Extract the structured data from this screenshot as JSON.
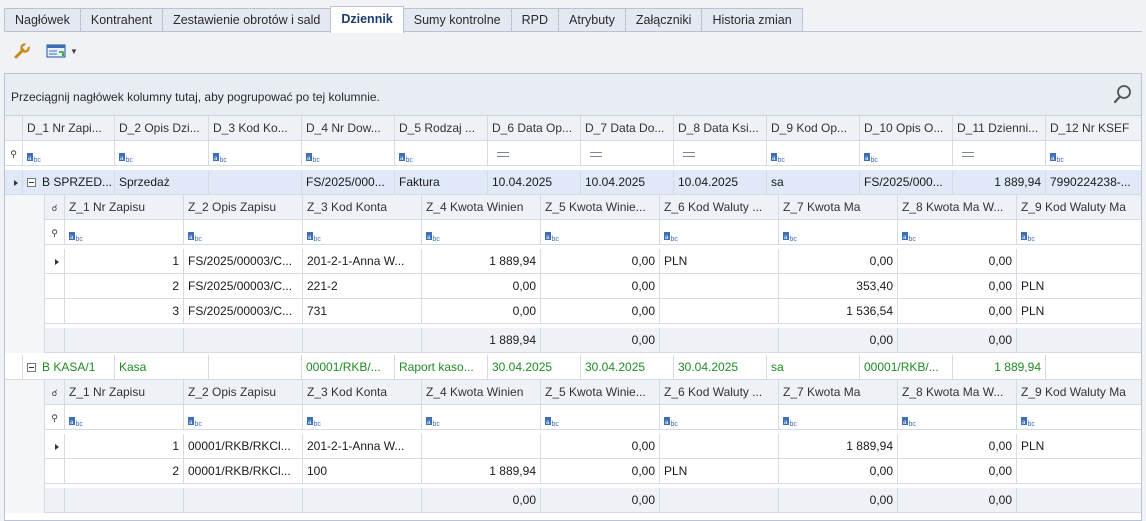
{
  "tabs": [
    "Nagłówek",
    "Kontrahent",
    "Zestawienie obrotów i sald",
    "Dziennik",
    "Sumy kontrolne",
    "RPD",
    "Atrybuty",
    "Załączniki",
    "Historia zmian"
  ],
  "active_tab": "Dziennik",
  "toolbar": {
    "tool_icon": "wrench-icon",
    "view_icon": "grid-view-icon"
  },
  "grid": {
    "group_hint": "Przeciągnij nagłówek kolumny tutaj, aby pogrupować po tej kolumnie.",
    "columns": [
      "D_1 Nr Zapi...",
      "D_2 Opis Dzi...",
      "D_3 Kod Ko...",
      "D_4 Nr Dow...",
      "D_5 Rodzaj ...",
      "D_6 Data Op...",
      "D_7 Data Do...",
      "D_8 Data Ksi...",
      "D_9 Kod Op...",
      "D_10 Opis O...",
      "D_11 Dzienni...",
      "D_12 Nr KSEF"
    ],
    "groups": [
      {
        "cells": [
          "B SPRZED...",
          "Sprzedaż",
          "",
          "FS/2025/000...",
          "Faktura",
          "10.04.2025",
          "10.04.2025",
          "10.04.2025",
          "sa",
          "FS/2025/000...",
          "1 889,94",
          "7990224238-..."
        ],
        "detail_columns": [
          "Z_1 Nr Zapisu",
          "Z_2 Opis Zapisu",
          "Z_3 Kod Konta",
          "Z_4 Kwota Winien",
          "Z_5 Kwota Winie...",
          "Z_6 Kod Waluty ...",
          "Z_7 Kwota Ma",
          "Z_8 Kwota Ma W...",
          "Z_9 Kod Waluty Ma"
        ],
        "rows": [
          [
            "1",
            "FS/2025/00003/C...",
            "201-2-1-Anna W...",
            "1 889,94",
            "0,00",
            "PLN",
            "0,00",
            "0,00",
            ""
          ],
          [
            "2",
            "FS/2025/00003/C...",
            "221-2",
            "0,00",
            "0,00",
            "",
            "353,40",
            "0,00",
            "PLN"
          ],
          [
            "3",
            "FS/2025/00003/C...",
            "731",
            "0,00",
            "0,00",
            "",
            "1 536,54",
            "0,00",
            "PLN"
          ]
        ],
        "footer": [
          "",
          "",
          "",
          "1 889,94",
          "0,00",
          "",
          "0,00",
          "0,00",
          ""
        ]
      },
      {
        "cells": [
          "B KASA/1",
          "Kasa",
          "",
          "00001/RKB/...",
          "Raport kaso...",
          "30.04.2025",
          "30.04.2025",
          "30.04.2025",
          "sa",
          "00001/RKB/...",
          "1 889,94",
          ""
        ],
        "detail_columns": [
          "Z_1 Nr Zapisu",
          "Z_2 Opis Zapisu",
          "Z_3 Kod Konta",
          "Z_4 Kwota Winien",
          "Z_5 Kwota Winie...",
          "Z_6 Kod Waluty ...",
          "Z_7 Kwota Ma",
          "Z_8 Kwota Ma W...",
          "Z_9 Kod Waluty Ma"
        ],
        "rows": [
          [
            "1",
            "00001/RKB/RKCl...",
            "201-2-1-Anna W...",
            "",
            "0,00",
            "",
            "1 889,94",
            "0,00",
            "PLN"
          ],
          [
            "2",
            "00001/RKB/RKCl...",
            "100",
            "1 889,94",
            "0,00",
            "PLN",
            "0,00",
            "0,00",
            ""
          ]
        ],
        "footer": [
          "",
          "",
          "",
          "0,00",
          "0,00",
          "",
          "0,00",
          "0,00",
          ""
        ]
      }
    ]
  }
}
